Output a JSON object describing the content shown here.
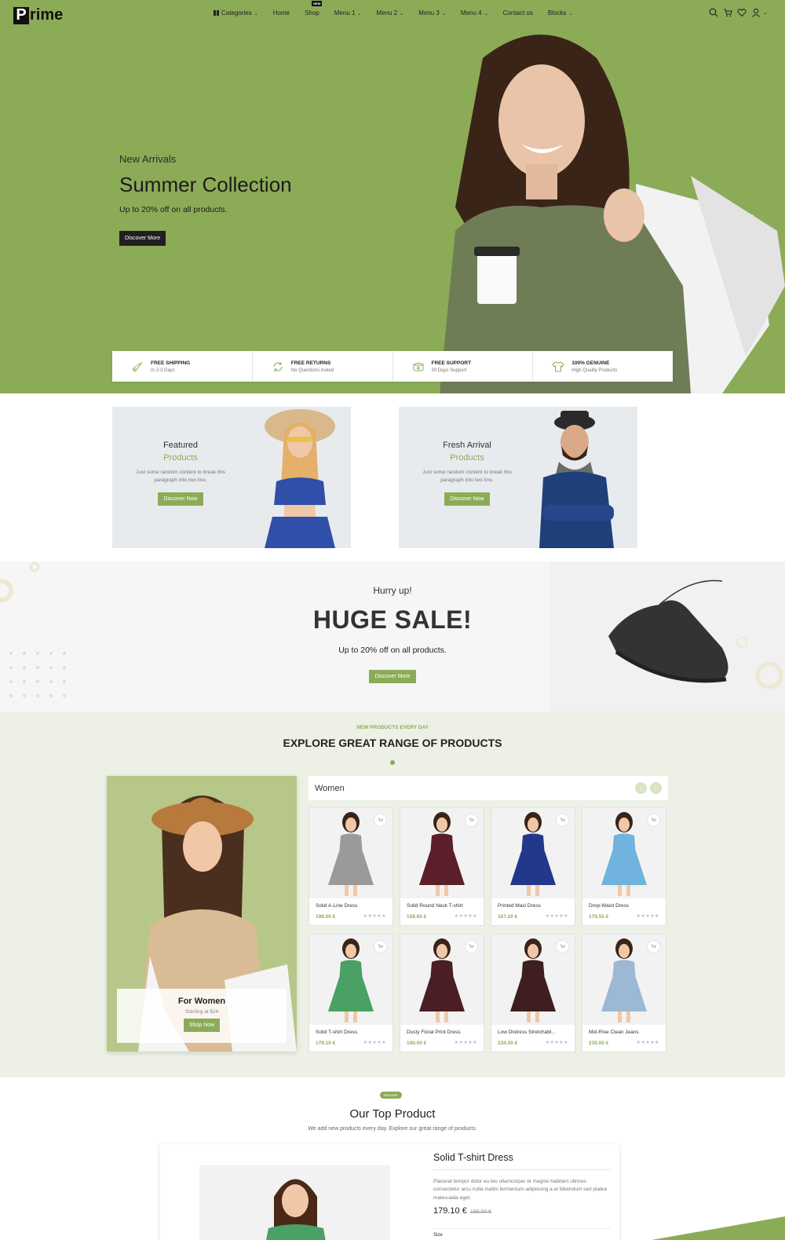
{
  "header": {
    "logo_initial": "P",
    "logo_rest": "rime",
    "nav": [
      {
        "label": "Categories",
        "caret": true
      },
      {
        "label": "Home",
        "caret": false
      },
      {
        "label": "Shop",
        "caret": false,
        "badge": "NEW"
      },
      {
        "label": "Menu 1",
        "caret": true
      },
      {
        "label": "Menu 2",
        "caret": true
      },
      {
        "label": "Menu 3",
        "caret": true
      },
      {
        "label": "Menu 4",
        "caret": true
      },
      {
        "label": "Contact us",
        "caret": false
      },
      {
        "label": "Blocks",
        "caret": true
      }
    ],
    "icons": [
      "search-icon",
      "cart-icon",
      "heart-icon",
      "user-icon"
    ]
  },
  "hero": {
    "eyebrow": "New Arrivals",
    "title": "Summer Collection",
    "subtitle": "Up to 20% off on all products.",
    "button": "Discover More"
  },
  "features": [
    {
      "icon": "rocket-icon",
      "title": "FREE SHIPPING",
      "subtitle": "In 2-3 Days"
    },
    {
      "icon": "refresh-icon",
      "title": "FREE RETURNS",
      "subtitle": "No Questions Asked"
    },
    {
      "icon": "phone-icon",
      "title": "FREE SUPPORT",
      "subtitle": "30 Days Support"
    },
    {
      "icon": "tshirt-icon",
      "title": "100% GENUINE",
      "subtitle": "High Quality Products"
    }
  ],
  "promos": [
    {
      "title": "Featured",
      "subtitle": "Products",
      "desc": "Just some random content to break this paragraph into two line.",
      "button": "Discover Now"
    },
    {
      "title": "Fresh Arrival",
      "subtitle": "Products",
      "desc": "Just some random content to break this paragraph into two line.",
      "button": "Discover Now"
    }
  ],
  "sale": {
    "eyebrow": "Hurry up!",
    "title": "HUGE SALE!",
    "subtitle": "Up to 20% off on all products.",
    "button": "Discover More"
  },
  "products": {
    "eyebrow": "NEW PRODUCTS EVERY DAY",
    "title": "EXPLORE GREAT RANGE OF PRODUCTS",
    "banner": {
      "title": "For Women",
      "subtitle": "Starting at $24",
      "button": "Shop Now"
    },
    "tab": "Women",
    "arrow_prev": "‹",
    "arrow_next": "›",
    "items": [
      {
        "name": "Solid A-Line Dress",
        "price": "198.00 €",
        "color": "#9a9a9a"
      },
      {
        "name": "Solid Round Neck T-shirt",
        "price": "158.65 €",
        "color": "#5a1f2a"
      },
      {
        "name": "Printed Maxi Dress",
        "price": "167.20 €",
        "color": "#22388a"
      },
      {
        "name": "Drop-Waist Dress",
        "price": "179.55 €",
        "color": "#6fb3de"
      },
      {
        "name": "Solid T-shirt Dress",
        "price": "179.10 €",
        "color": "#4aa065"
      },
      {
        "name": "Dusty Floral Print Dress",
        "price": "190.00 €",
        "color": "#4a1e24"
      },
      {
        "name": "Low Distress Stretchabl...",
        "price": "234.00 €",
        "color": "#3e1e1e"
      },
      {
        "name": "Mid-Rise Clean Jeans",
        "price": "235.00 €",
        "color": "#9cb8d4"
      }
    ],
    "stars": "★★★★★"
  },
  "top_product": {
    "pill": "Discover",
    "title": "Our Top Product",
    "subtitle": "We add new products every day. Explore our great range of products.",
    "name": "Solid T-shirt Dress",
    "desc": "Placerat tempor dolor eu leo ullamcorper et magnis habitant ultrices consectetur arcu nulla mattis fermentum adipiscing a et bibendum sed platea malesuada eget.",
    "price": "179.10 €",
    "old_price": "199.00 €",
    "size_label": "Size"
  },
  "colors": {
    "accent": "#8cab57",
    "dark": "#1f1f1f",
    "hero_bg": "#8cab57"
  }
}
